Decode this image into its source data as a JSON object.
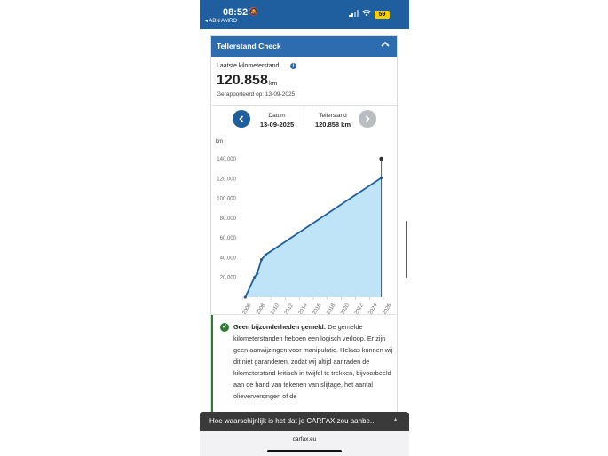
{
  "status_bar": {
    "time": "08:52",
    "back_label": "◂ ABN AMRO",
    "battery": "59"
  },
  "card": {
    "title": "Tellerstand Check",
    "latest_label": "Laatste kilometerstand",
    "latest_value": "120.858",
    "latest_unit": "km",
    "reported_on": "Gerapporteerd op: 13-09-2025"
  },
  "navigator": {
    "date_header": "Datum",
    "date_value": "13-09-2025",
    "reading_header": "Tellerstand",
    "reading_value": "120.858 km"
  },
  "chart_data": {
    "type": "area",
    "ylabel": "km",
    "ylim": [
      0,
      140000
    ],
    "y_ticks": [
      "0",
      "20.000",
      "40.000",
      "60.000",
      "80.000",
      "100.000",
      "120.000",
      "140.000"
    ],
    "x_ticks": [
      "2006",
      "2008",
      "2010",
      "2012",
      "2014",
      "2016",
      "2018",
      "2020",
      "2022",
      "2024",
      "2026"
    ],
    "xlim": [
      2005.5,
      2026.5
    ],
    "grid": false,
    "series": [
      {
        "points": [
          {
            "x": 2006.3,
            "y": 0
          },
          {
            "x": 2007.6,
            "y": 20000
          },
          {
            "x": 2008.0,
            "y": 24000
          },
          {
            "x": 2008.6,
            "y": 38000
          },
          {
            "x": 2009.2,
            "y": 43000
          },
          {
            "x": 2025.7,
            "y": 120858
          }
        ]
      }
    ],
    "selected_marker": {
      "x": 2025.7,
      "y": 140000
    },
    "colors": {
      "line": "#1f5fa0",
      "fill": "#bfe3f7",
      "marker": "#333333"
    }
  },
  "notice": {
    "heading": "Geen bijzonderheden gemeld:",
    "body": " De gemelde kilometerstanden hebben een logisch verloop. Er zijn geen aanwijzingen voor manipulatie. Helaas kunnen wij dit niet garanderen, zodat wij altijd aanraden de kilometerstand kritisch in twijfel te trekken, bijvoorbeeld aan de hand van tekenen van slijtage, het aantal olieverversingen of de"
  },
  "banner": {
    "text": "Hoe waarschijnlijk is het dat je CARFAX zou aanbe..."
  },
  "browser": {
    "url": "carfax.eu"
  },
  "icons": {
    "collapse": "chevron-up-icon",
    "info": "info-icon",
    "prev": "chevron-left-icon",
    "next": "chevron-right-icon",
    "check": "check-circle-icon"
  }
}
